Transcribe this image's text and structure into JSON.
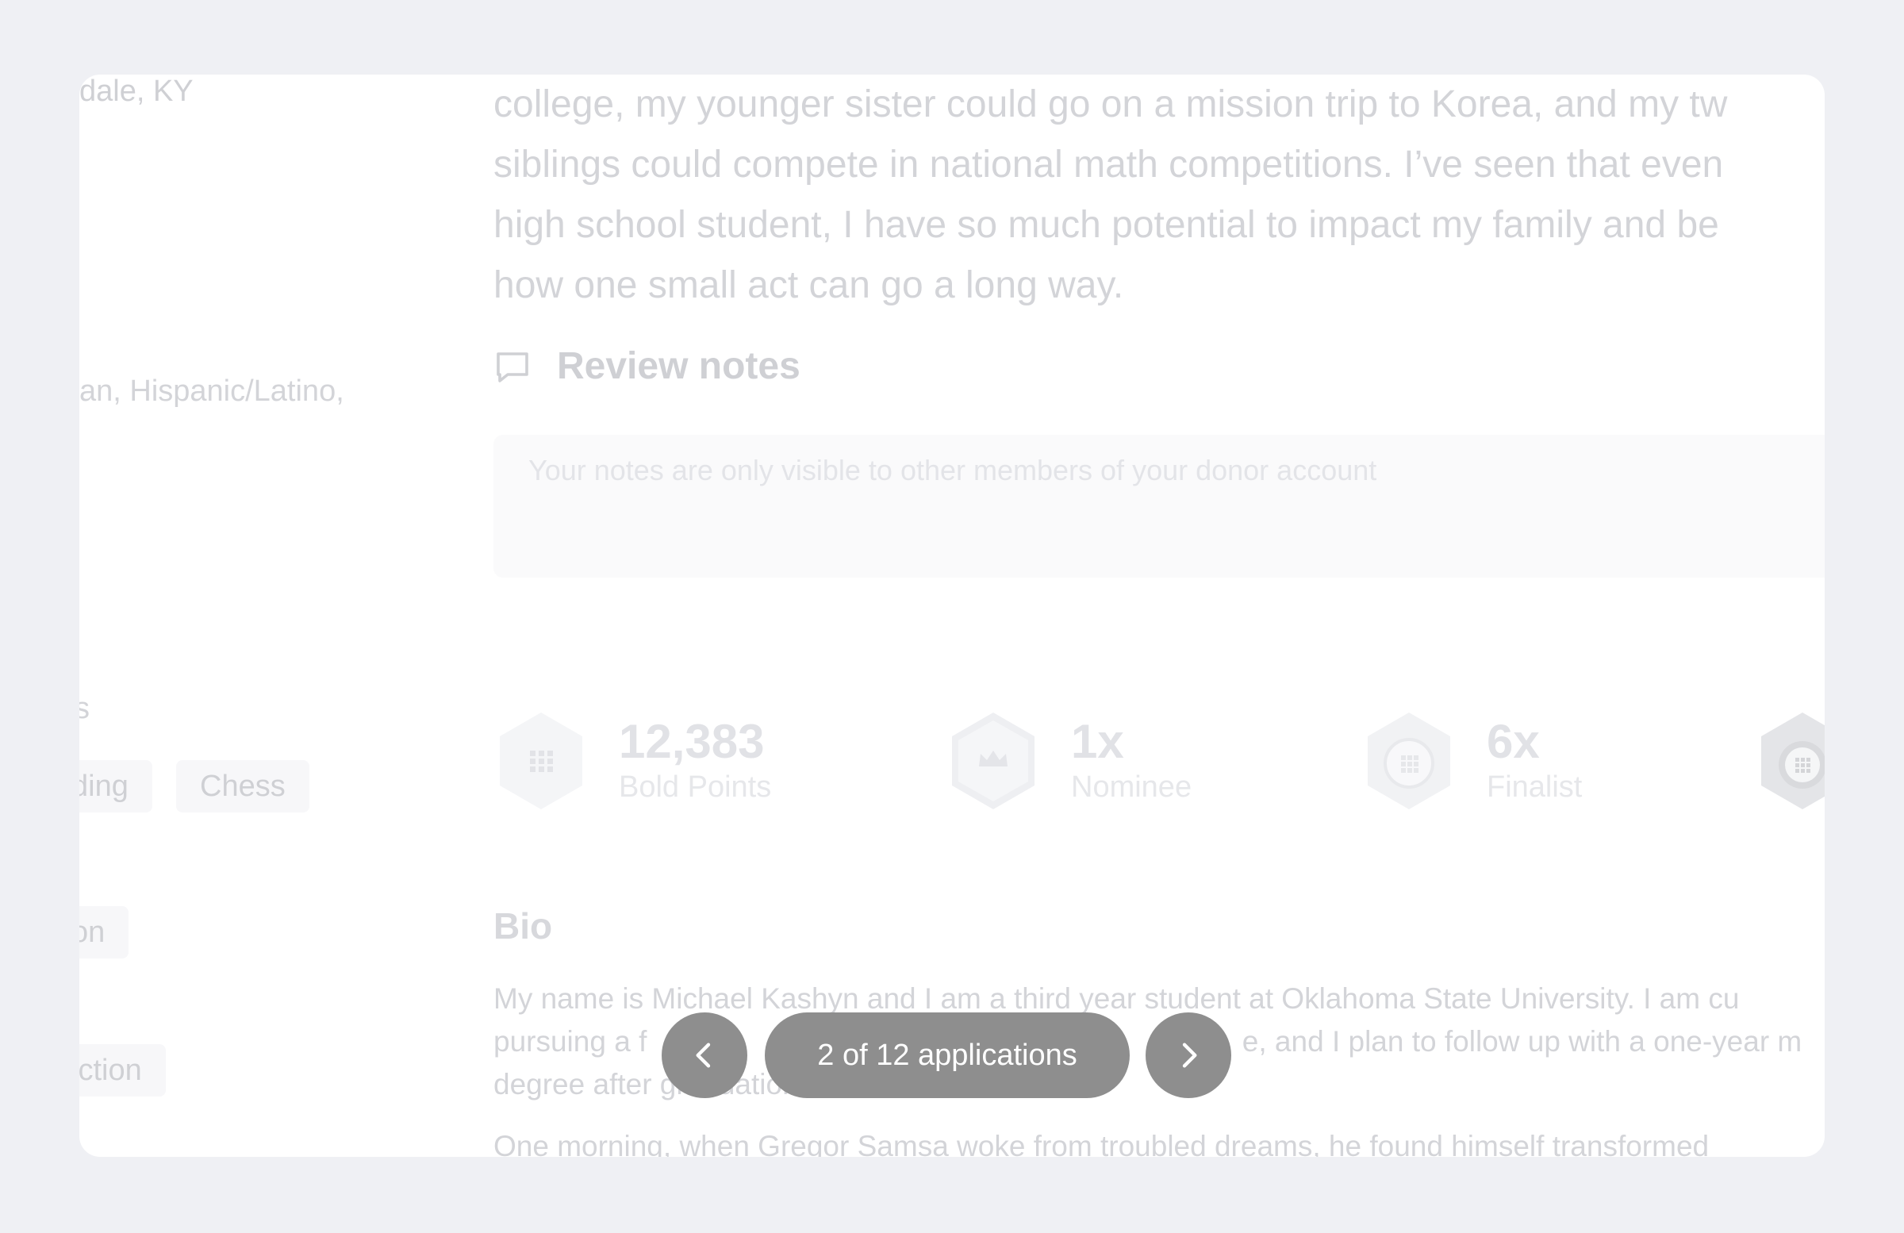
{
  "sidebar": {
    "location": "dale, KY",
    "ethnicity": "an, Hispanic/Latino,",
    "section_fragment": "s",
    "interest_tags": [
      "ding",
      "Chess"
    ],
    "tag_on": "on",
    "tag_fiction": "iction"
  },
  "essay": {
    "lines": [
      "college, my younger sister could go on a mission trip to Korea, and my tw",
      "siblings could compete in national math competitions. I’ve seen that even",
      "high school student, I have so much potential to impact my family and be",
      "how one small act can go a long way."
    ]
  },
  "review_notes": {
    "title": "Review notes",
    "placeholder": "Your notes are only visible to other members of your donor account"
  },
  "stats": [
    {
      "value": "12,383",
      "label": "Bold Points",
      "icon": "bold-points-icon"
    },
    {
      "value": "1x",
      "label": "Nominee",
      "icon": "nominee-crown-icon"
    },
    {
      "value": "6x",
      "label": "Finalist",
      "icon": "finalist-badge-icon"
    },
    {
      "value": "",
      "label": "",
      "icon": "winner-badge-icon"
    }
  ],
  "bio": {
    "title": "Bio",
    "lines": [
      "My name is Michael Kashyn and I am a third year student at Oklahoma State University. I am cu",
      "pursuing a f                        a                                               e, and I plan to follow up with a one-year m",
      "degree after graduation."
    ],
    "para2": "One morning, when Gregor Samsa woke from troubled dreams, he found himself transformed"
  },
  "pager": {
    "label": "2 of 12 applications"
  },
  "colors": {
    "page_bg": "#eff0f4",
    "pill_bg": "#8e8e8e"
  }
}
